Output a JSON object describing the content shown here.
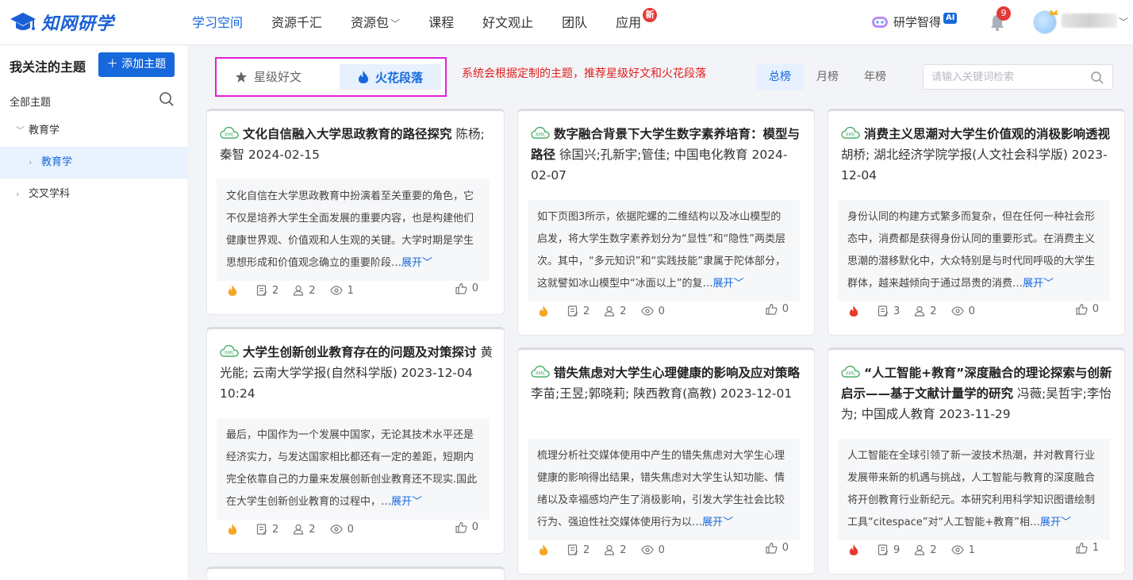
{
  "app": {
    "logo_text": "知网研学"
  },
  "nav": {
    "items": [
      {
        "label": "学习空间",
        "active": true
      },
      {
        "label": "资源千汇"
      },
      {
        "label": "资源包",
        "chevron": true
      },
      {
        "label": "课程"
      },
      {
        "label": "好文观止"
      },
      {
        "label": "团队"
      },
      {
        "label": "应用",
        "badge": "新"
      }
    ]
  },
  "header_right": {
    "ai_label": "研学智得",
    "ai_badge": "AI",
    "notification_count": "9"
  },
  "sidebar": {
    "title": "我关注的主题",
    "add_button": "添加主题",
    "all_topics": "全部主题",
    "tree": [
      {
        "label": "教育学",
        "expanded": true
      },
      {
        "label": "教育学",
        "selected": true
      },
      {
        "label": "交叉学科"
      }
    ]
  },
  "filters": {
    "tab_star": "星级好文",
    "tab_fire": "火花段落",
    "note": "系统会根据定制的主题，推荐星级好文和火花段落",
    "rank_tabs": [
      "总榜",
      "月榜",
      "年榜"
    ],
    "search_placeholder": "请输入关键词检索"
  },
  "cards": [
    {
      "title": "文化自信融入大学思政教育的路径探究",
      "meta": "陈杨; 秦智 2024-02-15",
      "abstract": "文化自信在大学思政教育中扮演着至关重要的角色，它不仅是培养大学生全面发展的重要内容，也是构建他们健康世界观、价值观和人生观的关键。大学时期是学生思想形成和价值观念确立的重要阶段…",
      "expand": "展开",
      "notes": "2",
      "users": "2",
      "views": "1",
      "likes": "0",
      "hot": false
    },
    {
      "title": "数字融合背景下大学生数字素养培育：模型与路径",
      "meta": "徐国兴;孔新宇;管佳; 中国电化教育 2024-02-07",
      "abstract": "如下页图3所示，依据陀螺的二维结构以及冰山模型的启发，将大学生数字素养划分为“显性”和“隐性”两类层次。其中，“多元知识”和“实践技能”隶属于陀体部分，这就譬如冰山模型中“冰面以上”的复…",
      "expand": "展开",
      "notes": "2",
      "users": "2",
      "views": "0",
      "likes": "0",
      "hot": false
    },
    {
      "title": "消费主义思潮对大学生价值观的消极影响透视",
      "meta": "胡桥; 湖北经济学院学报(人文社会科学版) 2023-12-04",
      "abstract": "身份认同的构建方式繁多而复杂，但在任何一种社会形态中，消费都是获得身份认同的重要形式。在消费主义思潮的潜移默化中，大众特别是与时代同呼吸的大学生群体，越来越倾向于通过昂贵的消费…",
      "expand": "展开",
      "notes": "3",
      "users": "2",
      "views": "0",
      "likes": "0",
      "hot": true
    },
    {
      "title": "大学生创新创业教育存在的问题及对策探讨",
      "meta": "黄光能; 云南大学学报(自然科学版) 2023-12-04 10:24",
      "abstract": "最后，中国作为一个发展中国家，无论其技术水平还是经济实力，与发达国家相比都还有一定的差距，短期内完全依靠自己的力量来发展创新创业教育还不现实.国此在大学生创新创业教育的过程中，…",
      "expand": "展开",
      "notes": "2",
      "users": "2",
      "views": "0",
      "likes": "0",
      "hot": false
    },
    {
      "title": "错失焦虑对大学生心理健康的影响及应对策略",
      "meta": "李苗;王昱;郭晓莉; 陕西教育(高教) 2023-12-01",
      "abstract": "梳理分析社交媒体使用中产生的错失焦虑对大学生心理健康的影响得出结果，错失焦虑对大学生认知功能、情绪以及幸福感均产生了消极影响，引发大学生社会比较行为、强迫性社交媒体使用行为以…",
      "expand": "展开",
      "notes": "2",
      "users": "2",
      "views": "0",
      "likes": "0",
      "hot": false
    },
    {
      "title": "“人工智能+教育”深度融合的理论探索与创新启示——基于文献计量学的研究",
      "meta": "冯薇;吴哲宇;李怡为; 中国成人教育 2023-11-29",
      "abstract": "人工智能在全球引领了新一波技术热潮，并对教育行业发展带来新的机遇与挑战，人工智能与教育的深度融合将开创教育行业新纪元。本研究利用科学知识图谱绘制工具“citespace”对“人工智能+教育”相…",
      "expand": "展开",
      "notes": "9",
      "users": "2",
      "views": "1",
      "likes": "1",
      "hot": true
    }
  ],
  "colors": {
    "brand": "#1668dc",
    "highlight_border": "#e221d6",
    "note_red": "#e02020",
    "fire_orange": "#f5a623",
    "fire_red": "#e8392a"
  }
}
